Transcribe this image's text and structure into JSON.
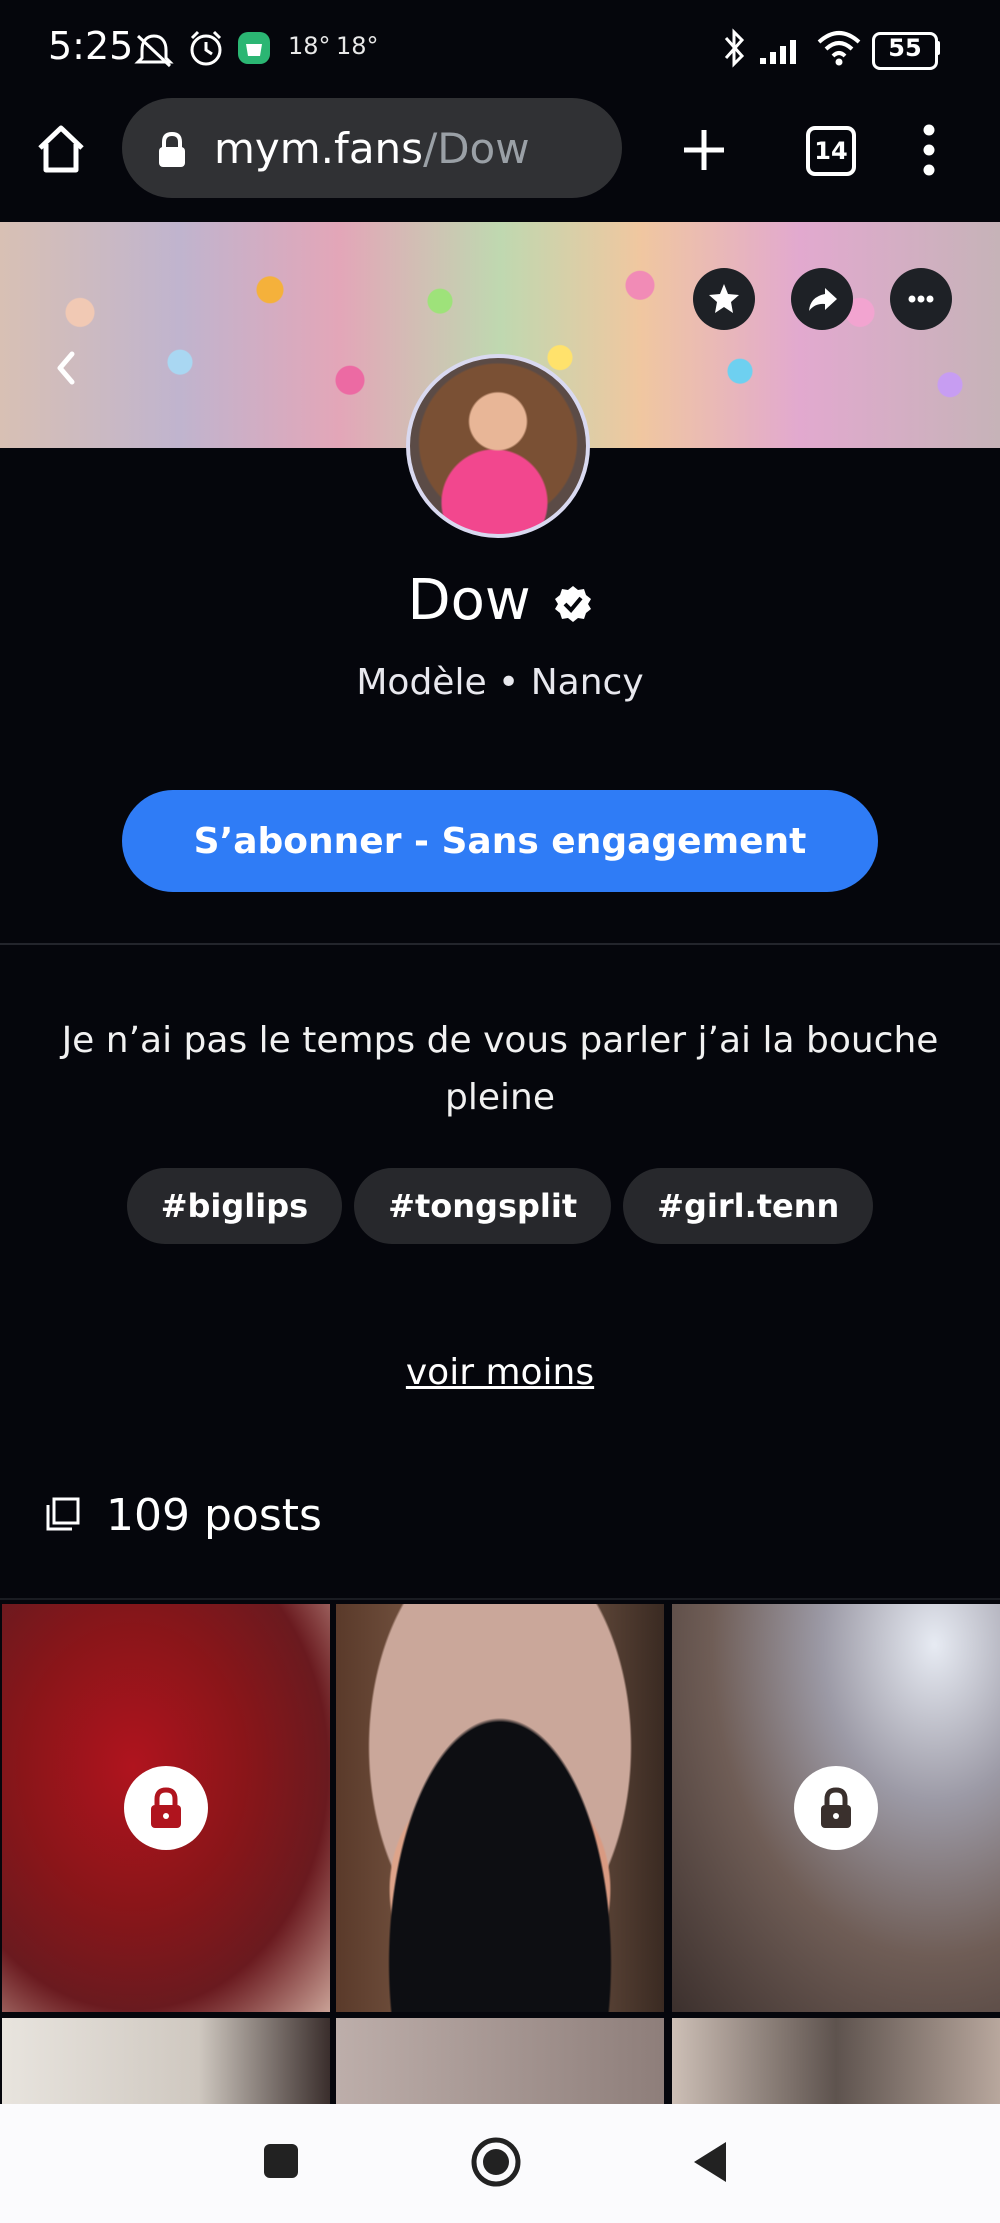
{
  "status_bar": {
    "time": "5:25",
    "temp1": "18°",
    "temp2": "18°",
    "battery": "55"
  },
  "browser": {
    "url_host": "mym.fans",
    "url_path": "/Dow",
    "tab_count": "14"
  },
  "profile": {
    "name": "Dow",
    "role_line": "Modèle • Nancy",
    "subscribe_label": "S’abonner - Sans engagement",
    "bio": "Je n’ai pas le temps de vous parler j’ai la bouche pleine",
    "tags": [
      "#biglips",
      "#tongsplit",
      "#girl.tenn"
    ],
    "voir_moins": "voir moins",
    "posts_count": "109 posts"
  },
  "colors": {
    "accent": "#2f7cf6",
    "background": "#05060c",
    "pill": "#27282c"
  },
  "posts_grid": [
    {
      "locked": true
    },
    {
      "locked": false
    },
    {
      "locked": true
    }
  ]
}
